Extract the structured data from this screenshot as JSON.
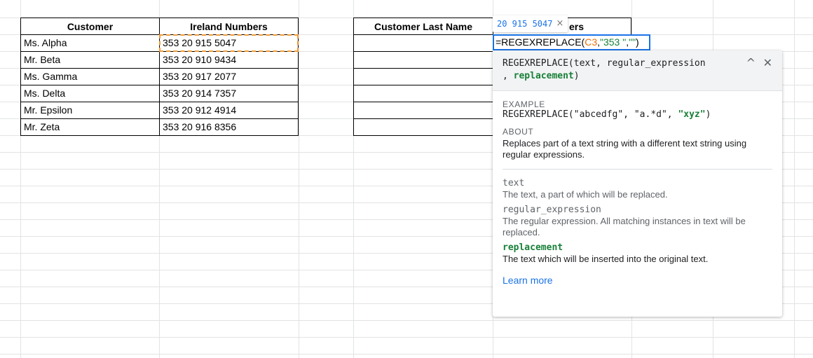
{
  "table1": {
    "headers": [
      "Customer",
      "Ireland Numbers"
    ],
    "rows": [
      [
        "Ms. Alpha",
        "353 20 915 5047"
      ],
      [
        "Mr. Beta",
        "353 20 910 9434"
      ],
      [
        "Ms. Gamma",
        "353 20 917 2077"
      ],
      [
        "Ms. Delta",
        "353 20 914 7357"
      ],
      [
        "Mr. Epsilon",
        "353 20 912 4914"
      ],
      [
        "Mr. Zeta",
        "353 20 916 8356"
      ]
    ]
  },
  "table2": {
    "headers": [
      "Customer Last Name",
      "ers"
    ]
  },
  "editor": {
    "prefix": "=REGEXREPLACE(",
    "ref": "C3",
    "sep1": ",",
    "str1": "\"353 \"",
    "sep2": ",",
    "str2": "\"\"",
    "suffix": ")"
  },
  "preview": {
    "value": "20 915 5047",
    "close": "×"
  },
  "help": {
    "signature_fn": "REGEXREPLACE(",
    "signature_args": "text, regular_expression",
    "signature_line2_prefix": ", ",
    "signature_active_arg": "replacement",
    "signature_close": ")",
    "collapse_glyph": "^",
    "close_glyph": "✕",
    "example_label": "EXAMPLE",
    "example_prefix": "REGEXREPLACE(\"abcedfg\", \"a.*d\", ",
    "example_active": "\"xyz\"",
    "example_suffix": ")",
    "about_label": "ABOUT",
    "about_text": "Replaces part of a text string with a different text string using regular expressions.",
    "args": [
      {
        "name": "text",
        "desc": "The text, a part of which will be replaced.",
        "active": false
      },
      {
        "name": "regular_expression",
        "desc": "The regular expression. All matching instances in text will be replaced.",
        "active": false
      },
      {
        "name": "replacement",
        "desc": "The text which will be inserted into the original text.",
        "active": true
      }
    ],
    "learn_more": "Learn more"
  },
  "colors": {
    "accent": "#1a73e8",
    "reference": "#e8710a",
    "string": "#188038",
    "selection_dash": "#f29b38"
  }
}
